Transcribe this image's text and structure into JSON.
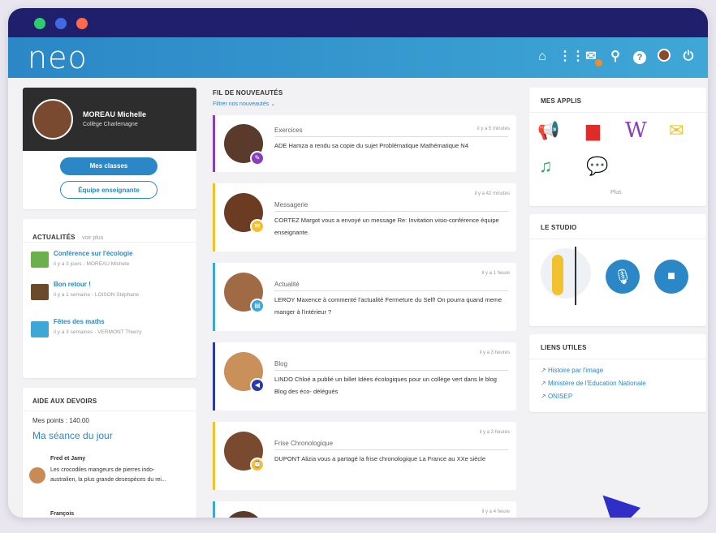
{
  "app": {
    "logo": "neo"
  },
  "window_dots": [
    "#2ecc71",
    "#4169e1",
    "#ff6b4a"
  ],
  "topbar_icons": [
    "home-icon",
    "apps-grid-icon",
    "mail-icon",
    "search-icon",
    "help-icon",
    "user-avatar-icon",
    "power-icon"
  ],
  "profile": {
    "name": "MOREAU Michelle",
    "school": "Collège Charlemagne",
    "btn_classes": "Mes classes",
    "btn_team": "Équipe enseignante"
  },
  "actualites": {
    "title": "ACTUALITÉS",
    "more": "voir plus",
    "items": [
      {
        "title": "Conférence sur l'écologie",
        "sub": "il y a 3 jours - MOREAU Michele"
      },
      {
        "title": "Bon retour !",
        "sub": "il y a 1 semaine - LOISON Stéphane"
      },
      {
        "title": "Fêtes des maths",
        "sub": "il y a 3 semaines - VERMONT Thierry"
      }
    ]
  },
  "devoirs": {
    "title": "AIDE AUX DEVOIRS",
    "points": "Mes points : 140.00",
    "seance": "Ma séance du jour",
    "names": "Fred et Jamy",
    "text": "Les crocodiles mangeurs de pierres indo-australien, la plus grande desespèces du rei...",
    "next": "François"
  },
  "feed": {
    "title": "FIL DE NOUVEAUTÉS",
    "filter": "Filtrer nos nouveautés",
    "items": [
      {
        "type": "Exercices",
        "time": "il y a 5 minutes",
        "text": "ADE Hamza a rendu sa copie du sujet Problématique Mathématique N4"
      },
      {
        "type": "Messagerie",
        "time": "il y a 42 minutes",
        "text": "CORTEZ Margot vous a envoyé un message Re: Invitation visio-conférence équipe enseignante."
      },
      {
        "type": "Actualité",
        "time": "il y a 1 heure",
        "text": "LEROY Maxence à commenté l'actualité Fermeture du Self! On pourra quand meme manger à l'intérieur ?"
      },
      {
        "type": "Blog",
        "time": "il y a 3 heures",
        "text": "LINDO Chloé a publié un billet Idées écologiques pour un collège vert dans le blog Blog des éco- délégués"
      },
      {
        "type": "Frise Chronologique",
        "time": "il y a 3 heures",
        "text": "DUPONT Alizia vous a partagé la frise chronologique La France au XXe siècle"
      },
      {
        "type": "",
        "time": "il y a 4 heure",
        "text": ""
      }
    ]
  },
  "applis": {
    "title": "MES APPLIS",
    "more": "Plus"
  },
  "studio": {
    "title": "LE STUDIO"
  },
  "liens": {
    "title": "LIENS UTILES",
    "items": [
      "Histoire par l'image",
      "Ministère de l'Education Nationale",
      "ONISEP"
    ]
  }
}
